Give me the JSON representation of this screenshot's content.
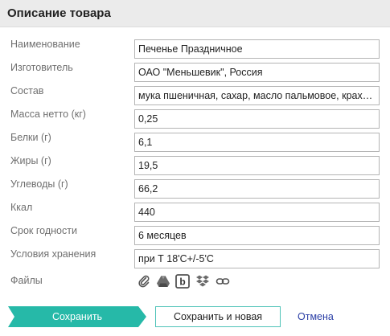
{
  "header": {
    "title": "Описание товара"
  },
  "form": {
    "fields": [
      {
        "label": "Наименование",
        "value": "Печенье Праздничное"
      },
      {
        "label": "Изготовитель",
        "value": "ОАО \"Меньшевик\", Россия"
      },
      {
        "label": "Состав",
        "value": "мука пшеничная, сахар, масло пальмовое, крахмал"
      },
      {
        "label": "Масса нетто (кг)",
        "value": "0,25"
      },
      {
        "label": "Белки (г)",
        "value": "6,1"
      },
      {
        "label": "Жиры (г)",
        "value": "19,5"
      },
      {
        "label": "Углеводы (г)",
        "value": "66,2"
      },
      {
        "label": "Ккал",
        "value": "440"
      },
      {
        "label": "Срок годности",
        "value": "6 месяцев"
      },
      {
        "label": "Условия хранения",
        "value": "при Т 18'С+/-5'С"
      }
    ],
    "files": {
      "label": "Файлы",
      "icons": [
        "paperclip-icon",
        "google-drive-icon",
        "box-icon",
        "dropbox-icon",
        "link-icon"
      ]
    }
  },
  "actions": {
    "save_label": "Сохранить",
    "save_new_label": "Сохранить и новая",
    "cancel_label": "Отмена"
  },
  "colors": {
    "accent": "#26b9a8",
    "accent_border": "#4fc3b8",
    "link": "#2b3fa6",
    "header_bg": "#ebebeb"
  }
}
